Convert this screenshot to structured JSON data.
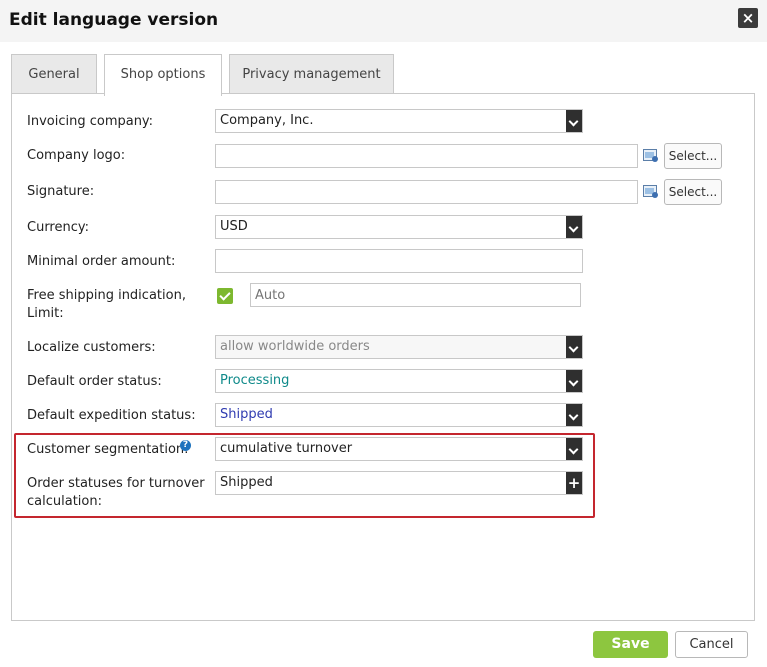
{
  "dialog": {
    "title": "Edit language version",
    "close_label": "×"
  },
  "tabs": [
    {
      "label": "General"
    },
    {
      "label": "Shop options",
      "active": true
    },
    {
      "label": "Privacy management"
    }
  ],
  "form": {
    "invoicing_company": {
      "label": "Invoicing company:",
      "value": "Company, Inc."
    },
    "company_logo": {
      "label": "Company logo:",
      "value": "",
      "select_label": "Select..."
    },
    "signature": {
      "label": "Signature:",
      "value": "",
      "select_label": "Select..."
    },
    "currency": {
      "label": "Currency:",
      "value": "USD"
    },
    "minimal_order": {
      "label": "Minimal order amount:",
      "value": ""
    },
    "free_shipping": {
      "label_line1": "Free shipping indication,",
      "label_line2": "Limit:",
      "checked": true,
      "placeholder": "Auto"
    },
    "localize_customers": {
      "label": "Localize customers:",
      "value": "allow worldwide orders"
    },
    "default_order_status": {
      "label": "Default order status:",
      "value": "Processing",
      "color": "#0f8a8a"
    },
    "default_expedition_status": {
      "label": "Default expedition status:",
      "value": "Shipped",
      "color": "#2f3bb0"
    },
    "customer_segmentation": {
      "label": "Customer segmentation:",
      "value": "cumulative turnover",
      "help": "?"
    },
    "turnover_statuses": {
      "label_line1": "Order statuses for turnover",
      "label_line2": "calculation:",
      "value": "Shipped",
      "add": "+"
    }
  },
  "footer": {
    "save_label": "Save",
    "cancel_label": "Cancel"
  },
  "colors": {
    "accent_green": "#8dc63f",
    "highlight_red": "#c4262e"
  }
}
